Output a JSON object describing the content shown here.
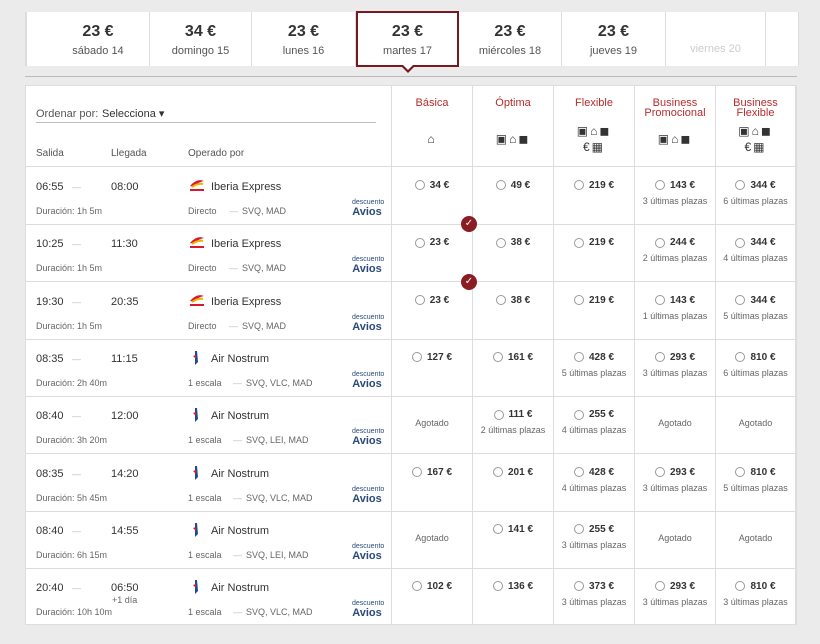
{
  "dates": [
    {
      "price": "23 €",
      "label": "sábado 14"
    },
    {
      "price": "34 €",
      "label": "domingo 15"
    },
    {
      "price": "23 €",
      "label": "lunes 16"
    },
    {
      "price": "23 €",
      "label": "martes 17",
      "selected": true
    },
    {
      "price": "23 €",
      "label": "miércoles 18"
    },
    {
      "price": "23 €",
      "label": "jueves 19"
    },
    {
      "price": "",
      "label": "viernes 20",
      "disabled": true
    }
  ],
  "sort": {
    "label": "Ordenar por:",
    "value": "Selecciona ▾"
  },
  "columns": {
    "salida": "Salida",
    "llegada": "Llegada",
    "operado": "Operado por"
  },
  "fares": [
    "Básica",
    "Óptima",
    "Flexible",
    "Business Promocional",
    "Business Flexible"
  ],
  "avios": {
    "top": "descuento",
    "bottom": "Avios"
  },
  "flights": [
    {
      "dep": "06:55",
      "arr": "08:00",
      "plus": "",
      "airline": "Iberia Express",
      "logo": "iberia-express-logo",
      "dur": "Duración: 1h 5m",
      "stops": "Directo",
      "route": "SVQ, MAD",
      "best": false,
      "fares": [
        {
          "p": "34 €",
          "n": ""
        },
        {
          "p": "49 €",
          "n": ""
        },
        {
          "p": "219 €",
          "n": ""
        },
        {
          "p": "143 €",
          "n": "3 últimas plazas"
        },
        {
          "p": "344 €",
          "n": "6 últimas plazas"
        }
      ]
    },
    {
      "dep": "10:25",
      "arr": "11:30",
      "plus": "",
      "airline": "Iberia Express",
      "logo": "iberia-express-logo",
      "dur": "Duración: 1h 5m",
      "stops": "Directo",
      "route": "SVQ, MAD",
      "best": true,
      "fares": [
        {
          "p": "23 €",
          "n": ""
        },
        {
          "p": "38 €",
          "n": ""
        },
        {
          "p": "219 €",
          "n": ""
        },
        {
          "p": "244 €",
          "n": "2 últimas plazas"
        },
        {
          "p": "344 €",
          "n": "4 últimas plazas"
        }
      ]
    },
    {
      "dep": "19:30",
      "arr": "20:35",
      "plus": "",
      "airline": "Iberia Express",
      "logo": "iberia-express-logo",
      "dur": "Duración: 1h 5m",
      "stops": "Directo",
      "route": "SVQ, MAD",
      "best": true,
      "fares": [
        {
          "p": "23 €",
          "n": ""
        },
        {
          "p": "38 €",
          "n": ""
        },
        {
          "p": "219 €",
          "n": ""
        },
        {
          "p": "143 €",
          "n": "1 últimas plazas"
        },
        {
          "p": "344 €",
          "n": "5 últimas plazas"
        }
      ]
    },
    {
      "dep": "08:35",
      "arr": "11:15",
      "plus": "",
      "airline": "Air Nostrum",
      "logo": "air-nostrum-logo",
      "dur": "Duración: 2h 40m",
      "stops": "1 escala",
      "route": "SVQ, VLC, MAD",
      "best": false,
      "fares": [
        {
          "p": "127 €",
          "n": ""
        },
        {
          "p": "161 €",
          "n": ""
        },
        {
          "p": "428 €",
          "n": "5 últimas plazas"
        },
        {
          "p": "293 €",
          "n": "3 últimas plazas"
        },
        {
          "p": "810 €",
          "n": "6 últimas plazas"
        }
      ]
    },
    {
      "dep": "08:40",
      "arr": "12:00",
      "plus": "",
      "airline": "Air Nostrum",
      "logo": "air-nostrum-logo",
      "dur": "Duración: 3h 20m",
      "stops": "1 escala",
      "route": "SVQ, LEI, MAD",
      "best": false,
      "fares": [
        {
          "p": "",
          "n": "",
          "sold": "Agotado"
        },
        {
          "p": "111 €",
          "n": "2 últimas plazas"
        },
        {
          "p": "255 €",
          "n": "4 últimas plazas"
        },
        {
          "p": "",
          "n": "",
          "sold": "Agotado"
        },
        {
          "p": "",
          "n": "",
          "sold": "Agotado"
        }
      ]
    },
    {
      "dep": "08:35",
      "arr": "14:20",
      "plus": "",
      "airline": "Air Nostrum",
      "logo": "air-nostrum-logo",
      "dur": "Duración: 5h 45m",
      "stops": "1 escala",
      "route": "SVQ, VLC, MAD",
      "best": false,
      "fares": [
        {
          "p": "167 €",
          "n": ""
        },
        {
          "p": "201 €",
          "n": ""
        },
        {
          "p": "428 €",
          "n": "4 últimas plazas"
        },
        {
          "p": "293 €",
          "n": "3 últimas plazas"
        },
        {
          "p": "810 €",
          "n": "5 últimas plazas"
        }
      ]
    },
    {
      "dep": "08:40",
      "arr": "14:55",
      "plus": "",
      "airline": "Air Nostrum",
      "logo": "air-nostrum-logo",
      "dur": "Duración: 6h 15m",
      "stops": "1 escala",
      "route": "SVQ, LEI, MAD",
      "best": false,
      "fares": [
        {
          "p": "",
          "n": "",
          "sold": "Agotado"
        },
        {
          "p": "141 €",
          "n": ""
        },
        {
          "p": "255 €",
          "n": "3 últimas plazas"
        },
        {
          "p": "",
          "n": "",
          "sold": "Agotado"
        },
        {
          "p": "",
          "n": "",
          "sold": "Agotado"
        }
      ]
    },
    {
      "dep": "20:40",
      "arr": "06:50",
      "plus": "+1 día",
      "airline": "Air Nostrum",
      "logo": "air-nostrum-logo",
      "dur": "Duración: 10h 10m",
      "stops": "1 escala",
      "route": "SVQ, VLC, MAD",
      "best": false,
      "fares": [
        {
          "p": "102 €",
          "n": ""
        },
        {
          "p": "136 €",
          "n": ""
        },
        {
          "p": "373 €",
          "n": "3 últimas plazas"
        },
        {
          "p": "293 €",
          "n": "3 últimas plazas"
        },
        {
          "p": "810 €",
          "n": "3 últimas plazas"
        }
      ]
    }
  ]
}
